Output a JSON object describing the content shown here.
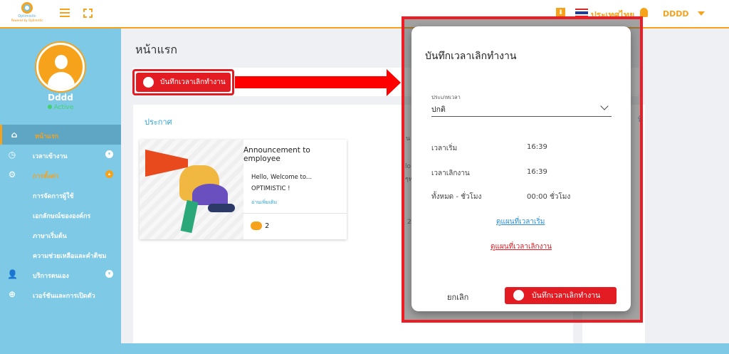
{
  "header": {
    "logo_name": "Optimistic",
    "logo_powered": "Powered by Optimistic",
    "language": "ประเทศไทย",
    "user": "DDDD"
  },
  "sidebar": {
    "name": "Dddd",
    "status": "Active",
    "items": [
      {
        "label": "หน้าแรก"
      },
      {
        "label": "เวลาเข้างาน"
      },
      {
        "label": "การตั้งค่า"
      },
      {
        "label": "การจัดการผู้ใช้"
      },
      {
        "label": "เอกลักษณ์ขององค์กร"
      },
      {
        "label": "ภาษาเริ่มต้น"
      },
      {
        "label": "ความช่วยเหลือและคำติชม"
      },
      {
        "label": "บริการตนเอง"
      },
      {
        "label": "เวอร์ชันและการเปิดตัว"
      }
    ]
  },
  "main": {
    "page_title": "หน้าแรก",
    "record_button": "บันทึกเวลาเลิกทำงาน",
    "announce_title": "ประกาศ",
    "right_peek": "ที่",
    "card": {
      "heading": "Announcement to employee",
      "line1": "Hello, Welcome to...",
      "line2": "OPTIMISTIC !",
      "more": "อ่านเพิ่มเติม",
      "comments": "2"
    },
    "peek_texts": [
      "น",
      "lo",
      "ๆท",
      "2"
    ]
  },
  "modal": {
    "title": "บันทึกเวลาเลิกทำงาน",
    "type_label": "ประเภทเวลา",
    "type_value": "ปกติ",
    "rows": [
      {
        "label": "เวลาเริ่ม",
        "value": "16:39"
      },
      {
        "label": "เวลาเลิกงาน",
        "value": "16:39"
      },
      {
        "label": "ทั้งหมด - ชั่วโมง",
        "value": "00:00 ชั่วโมง"
      }
    ],
    "map_start_link": "ดูแผนที่เวลาเริ่ม",
    "map_end_link": "ดูแผนที่เวลาเลิกงาน",
    "cancel": "ยกเลิก",
    "submit": "บันทึกเวลาเลิกทำงาน"
  }
}
